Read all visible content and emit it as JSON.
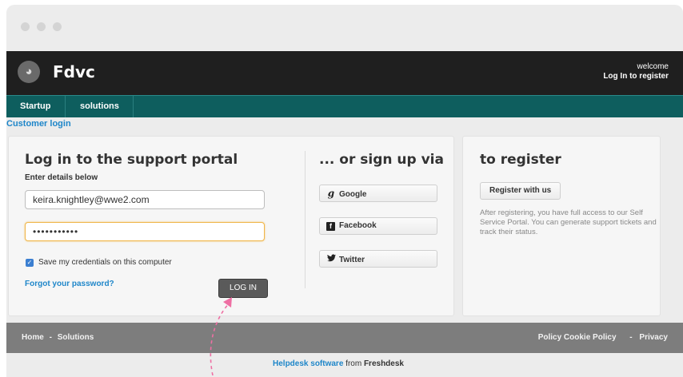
{
  "header": {
    "brand": "Fdvc",
    "welcome": "welcome",
    "login_link": "Log In",
    "register_link": "to register"
  },
  "nav": {
    "items": [
      {
        "label": "Startup"
      },
      {
        "label": "solutions"
      }
    ]
  },
  "customer_login": "Customer login",
  "login": {
    "title": "Log in to the support portal",
    "subtitle": "Enter details below",
    "email_value": "keira.knightley@wwe2.com",
    "password_value": "•••••••••••",
    "remember_label": "Save my credentials on this computer",
    "forgot_label": "Forgot your password?",
    "login_button": "LOG IN"
  },
  "signup": {
    "title": "... or sign up via",
    "google": "Google",
    "facebook": "Facebook",
    "twitter": "Twitter"
  },
  "register": {
    "title": "to register",
    "button": "Register with us",
    "text": "After registering, you have full access to our Self Service Portal. You can generate support tickets and track their status."
  },
  "footer": {
    "home": "Home",
    "solutions": "Solutions",
    "sep": "-",
    "policy": "Policy Cookie Policy",
    "privacy": "Privacy"
  },
  "powered": {
    "link": "Helpdesk software",
    "rest": " from ",
    "brand": "Freshdesk"
  },
  "colors": {
    "nav_bg": "#0e5e5e",
    "header_bg": "#1f1f1f",
    "link_blue": "#1e86c9",
    "annotation_arrow": "#ee6fa3"
  }
}
